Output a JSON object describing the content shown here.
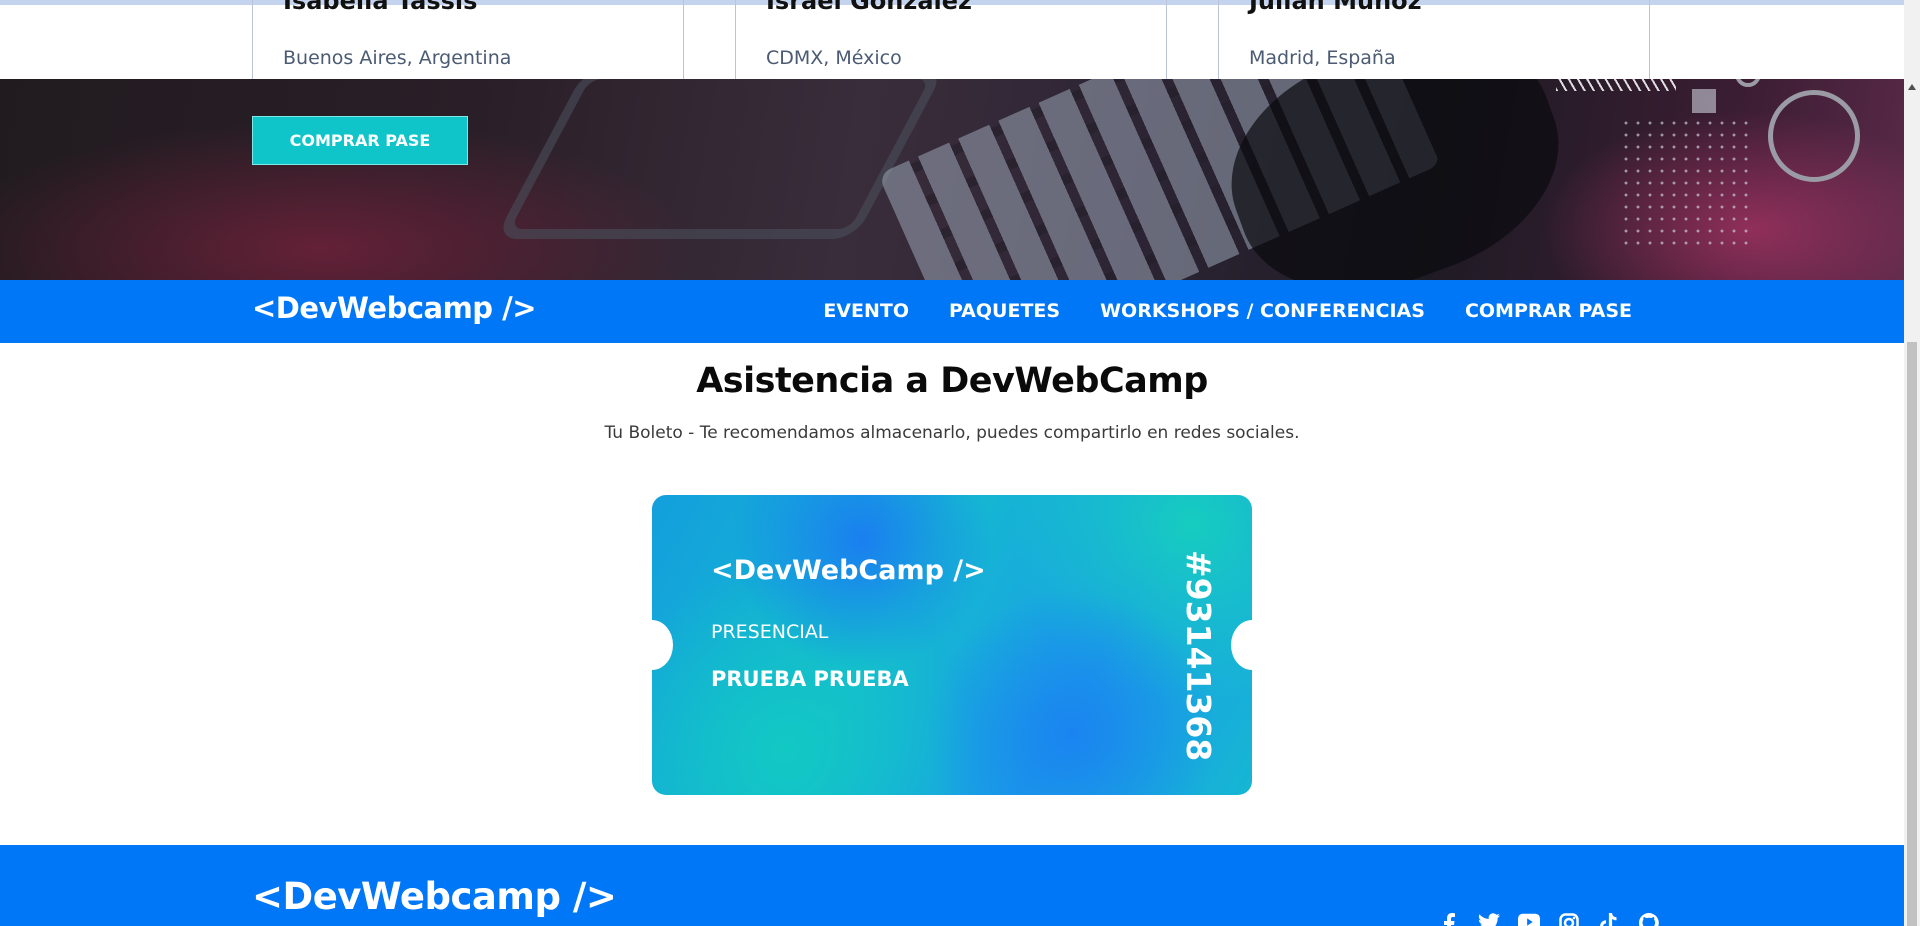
{
  "speakers": [
    {
      "name": "Isabella Tassis",
      "location": "Buenos Aires, Argentina"
    },
    {
      "name": "Israel González",
      "location": "CDMX, México"
    },
    {
      "name": "Julián Muñoz",
      "location": "Madrid, España"
    }
  ],
  "hero": {
    "buy_button": "COMPRAR PASE"
  },
  "navbar": {
    "logo": "<DevWebcamp />",
    "links": [
      "EVENTO",
      "PAQUETES",
      "WORKSHOPS / CONFERENCIAS",
      "COMPRAR PASE"
    ]
  },
  "main": {
    "title": "Asistencia a DevWebCamp",
    "subtitle": "Tu Boleto - Te recomendamos almacenarlo, puedes compartirlo en redes sociales."
  },
  "ticket": {
    "logo": "<DevWebCamp />",
    "plan": "PRESENCIAL",
    "name": "PRUEBA PRUEBA",
    "code": "#93141368"
  },
  "footer": {
    "logo": "<DevWebcamp />",
    "socials": [
      "facebook-icon",
      "twitter-icon",
      "youtube-icon",
      "instagram-icon",
      "tiktok-icon",
      "github-icon"
    ]
  },
  "colors": {
    "brand_blue": "#0077f7",
    "accent_teal": "#10c5c9"
  }
}
